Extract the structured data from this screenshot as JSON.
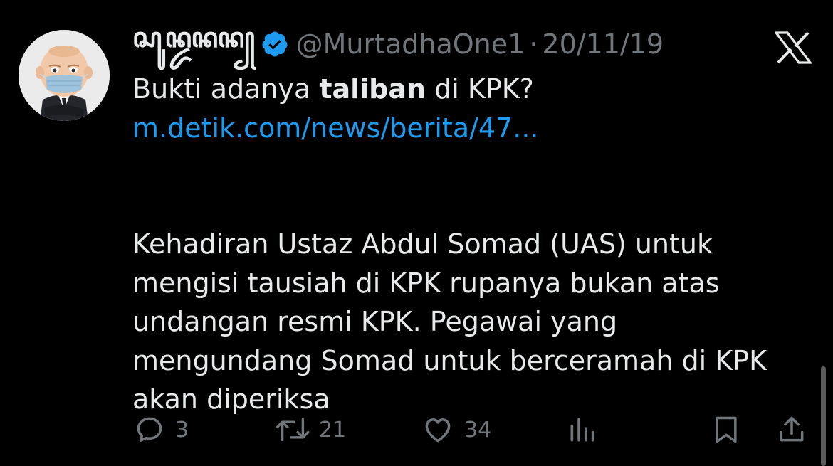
{
  "tweet": {
    "author": {
      "display_name": "ꦱꦸꦤ꧀ꦢꦤꦤ꧀",
      "handle": "@MurtadhaOne1",
      "verified": true,
      "avatar_icon": "boss-baby-avatar-with-mask"
    },
    "separator": "·",
    "date": "20/11/19",
    "text": {
      "prefix": "Bukti adanya ",
      "bold": "taliban",
      "suffix": " di KPK?"
    },
    "link": "m.detik.com/news/berita/47...",
    "quote_lines": [
      "Kehadiran Ustaz Abdul Somad (UAS) untuk",
      "mengisi tausiah di KPK rupanya bukan atas",
      "undangan resmi KPK. Pegawai yang",
      "mengundang Somad untuk berceramah di KPK",
      "akan diperiksa"
    ]
  },
  "actions": {
    "replies": "3",
    "retweets": "21",
    "likes": "34"
  },
  "colors": {
    "background": "#000000",
    "text": "#e7e9ea",
    "muted": "#71767b",
    "link": "#1d9bf0",
    "verified": "#1d9bf0"
  }
}
